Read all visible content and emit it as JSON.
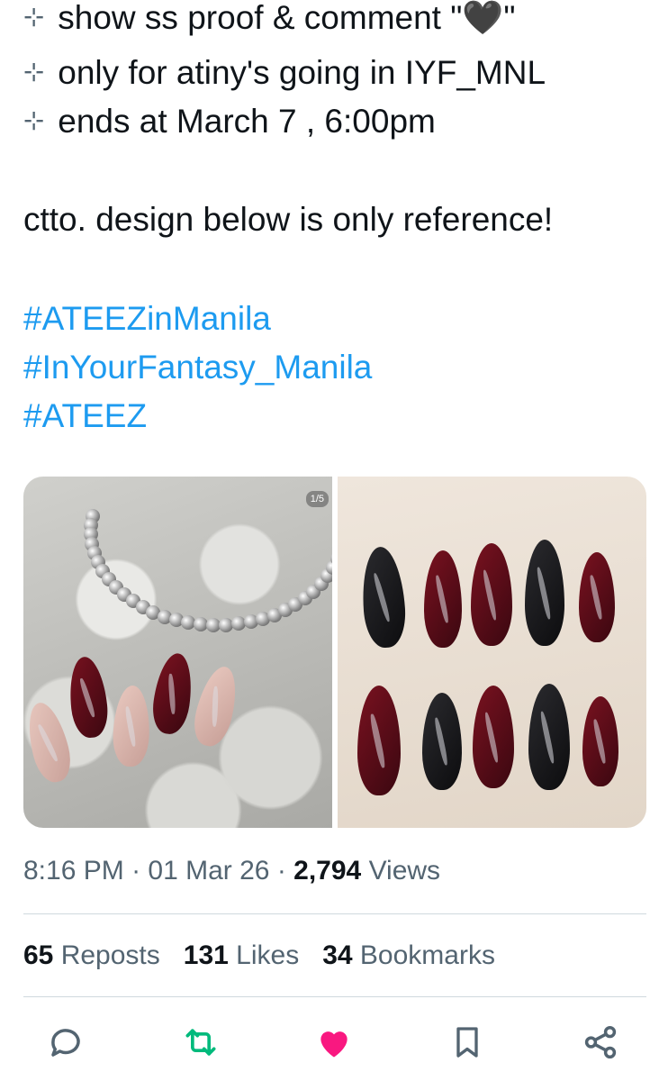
{
  "tweet": {
    "lines": [
      "show ss proof & comment \"🖤\"",
      "only for atiny's going in IYF_MNL",
      "ends at March 7 , 6:00pm"
    ],
    "bullet": "⊹",
    "note": "ctto. design below is only reference!",
    "hashtags": [
      "#ATEEZinManila",
      "#InYourFantasy_Manila",
      "#ATEEZ"
    ]
  },
  "media": {
    "counter": "1/5"
  },
  "meta": {
    "time": "8:16 PM",
    "separator": " · ",
    "date": "01 Mar 26",
    "views_count": "2,794",
    "views_label": " Views"
  },
  "stats": {
    "reposts_count": "65",
    "reposts_label": " Reposts",
    "likes_count": "131",
    "likes_label": " Likes",
    "bookmarks_count": "34",
    "bookmarks_label": " Bookmarks"
  },
  "colors": {
    "hashtag": "#1d9bf0",
    "repost_active": "#00ba7c",
    "like_active": "#f91880",
    "icon_default": "#536471"
  },
  "actions": [
    "reply-icon",
    "repost-icon",
    "like-icon",
    "bookmark-icon",
    "share-icon"
  ]
}
